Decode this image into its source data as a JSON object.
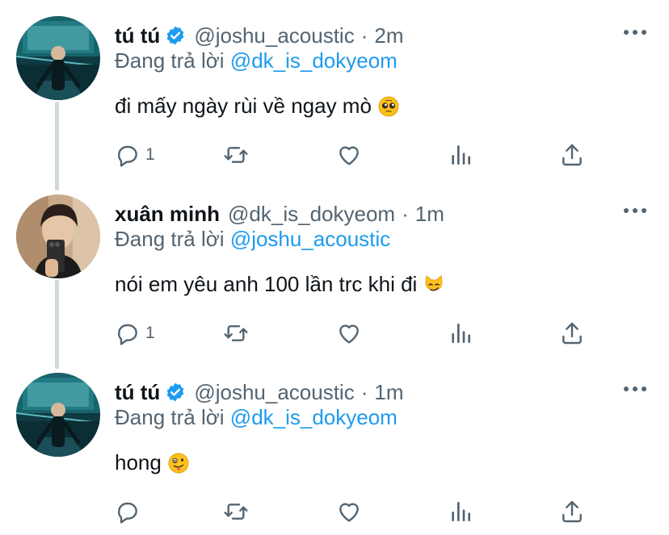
{
  "tweets": [
    {
      "name": "tú tú",
      "verified": true,
      "handle": "@joshu_acoustic",
      "separator": "·",
      "time": "2m",
      "reply_prefix": "Đang trả lời",
      "reply_to": "@dk_is_dokyeom",
      "text": "đi mấy ngày rùi về ngay mò",
      "emoji": "pleading-face",
      "reply_count": "1",
      "avatar": "avatar-blue-stage"
    },
    {
      "name": "xuân minh",
      "verified": false,
      "handle": "@dk_is_dokyeom",
      "separator": "·",
      "time": "1m",
      "reply_prefix": "Đang trả lời",
      "reply_to": "@joshu_acoustic",
      "text": "nói em yêu anh 100 lần trc khi đi",
      "emoji": "smirking-cat",
      "reply_count": "1",
      "avatar": "avatar-mirror-selfie"
    },
    {
      "name": "tú tú",
      "verified": true,
      "handle": "@joshu_acoustic",
      "separator": "·",
      "time": "1m",
      "reply_prefix": "Đang trả lời",
      "reply_to": "@dk_is_dokyeom",
      "text": "hong",
      "emoji": "zany-face",
      "reply_count": "",
      "avatar": "avatar-blue-stage"
    }
  ],
  "colors": {
    "link": "#1d9bf0",
    "secondary_text": "#536471",
    "thread_line": "#cfd9de",
    "verified": "#1d9bf0"
  },
  "icons": [
    "reply-icon",
    "retweet-icon",
    "like-icon",
    "views-icon",
    "share-icon",
    "more-icon",
    "verified-badge-icon"
  ]
}
